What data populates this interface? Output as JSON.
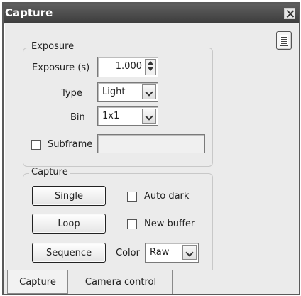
{
  "window": {
    "title": "Capture"
  },
  "exposure_group": {
    "legend": "Exposure",
    "exposure_label": "Exposure (s)",
    "exposure_value": "1.000",
    "type_label": "Type",
    "type_value": "Light",
    "bin_label": "Bin",
    "bin_value": "1x1",
    "subframe_label": "Subframe",
    "subframe_checked": false,
    "subframe_value": ""
  },
  "capture_group": {
    "legend": "Capture",
    "single_label": "Single",
    "loop_label": "Loop",
    "sequence_label": "Sequence",
    "auto_dark_label": "Auto dark",
    "auto_dark_checked": false,
    "new_buffer_label": "New buffer",
    "new_buffer_checked": false,
    "color_label": "Color",
    "color_value": "Raw"
  },
  "tabs": [
    {
      "label": "Capture",
      "active": true
    },
    {
      "label": "Camera control",
      "active": false
    }
  ]
}
